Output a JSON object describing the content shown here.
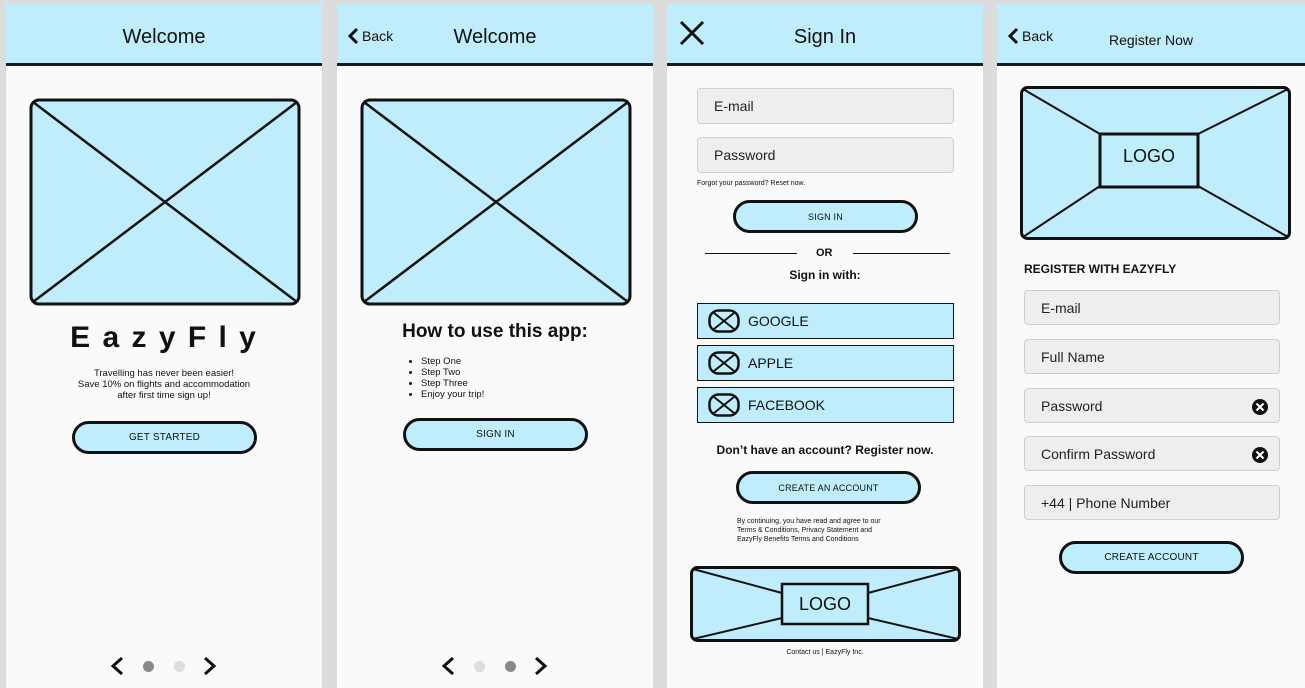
{
  "screen1": {
    "header_title": "Welcome",
    "brand": "E a z y F l y",
    "tagline_lines": [
      "Travelling has never been easier!",
      "Save 10% on flights and accommodation",
      "after first time sign up!"
    ],
    "cta": "GET STARTED",
    "page_dots": {
      "active": 1,
      "total": 2
    }
  },
  "screen2": {
    "back_label": "Back",
    "header_title": "Welcome",
    "heading": "How to use this app:",
    "steps": [
      "Step One",
      "Step Two",
      "Step Three",
      "Enjoy your trip!"
    ],
    "cta": "SIGN IN",
    "page_dots": {
      "active": 2,
      "total": 2
    }
  },
  "screen3": {
    "header_title": "Sign In",
    "email_placeholder": "E-mail",
    "password_placeholder": "Password",
    "forgot": "Forgot your password? Reset now.",
    "sign_in": "SIGN IN",
    "or": "OR",
    "sign_in_with": "Sign in with:",
    "social": [
      "GOOGLE",
      "APPLE",
      "FACEBOOK"
    ],
    "no_account": "Don’t have an account? Register now.",
    "create_account": "CREATE AN ACCOUNT",
    "legal_lines": [
      "By continuing, you have read and agree to our",
      "Terms & Conditions, Privacy Statement and",
      "EazyFly Benefits Terms and Conditions"
    ],
    "logo": "LOGO",
    "contact": "Contact us | EazyFly Inc."
  },
  "screen4": {
    "back_label": "Back",
    "header_title": "Register Now",
    "logo": "LOGO",
    "section_title": "REGISTER WITH EAZYFLY",
    "fields": [
      "E-mail",
      "Full Name",
      "Password",
      "Confirm Password",
      "+44 | Phone Number"
    ],
    "cta": "CREATE ACCOUNT"
  },
  "colors": {
    "accent": "#bfedfb",
    "stroke": "#111111",
    "panel": "#fafafa",
    "backdrop": "#dcdcdc"
  }
}
